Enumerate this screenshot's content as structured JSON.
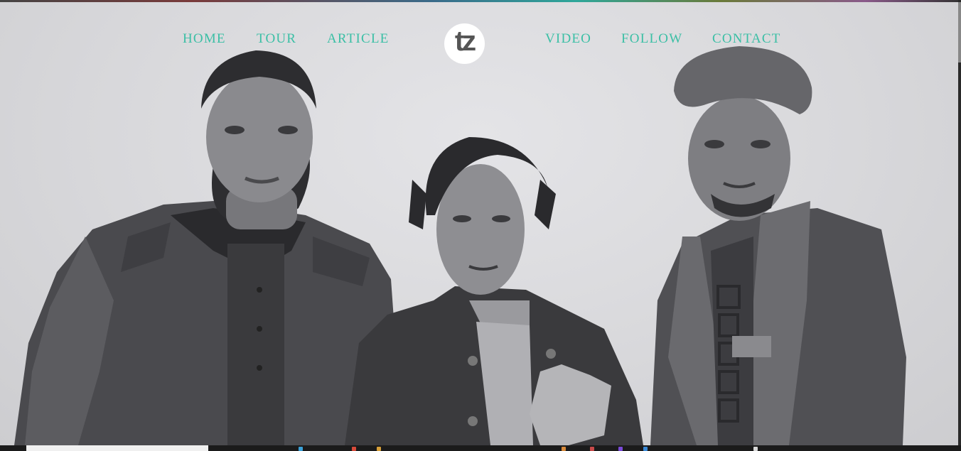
{
  "nav": {
    "items": [
      {
        "label": "HOME"
      },
      {
        "label": "TOUR"
      },
      {
        "label": "ARTICLE"
      },
      {
        "label": "VIDEO"
      },
      {
        "label": "FOLLOW"
      },
      {
        "label": "CONTACT"
      }
    ],
    "logo_text": "tz"
  },
  "hero": {
    "image": "three-men-portrait-greyscale"
  },
  "colors": {
    "nav_text": "#3bbfa5",
    "background": "#d9d9dc",
    "logo_bg": "#ffffff",
    "logo_text": "#555555"
  }
}
